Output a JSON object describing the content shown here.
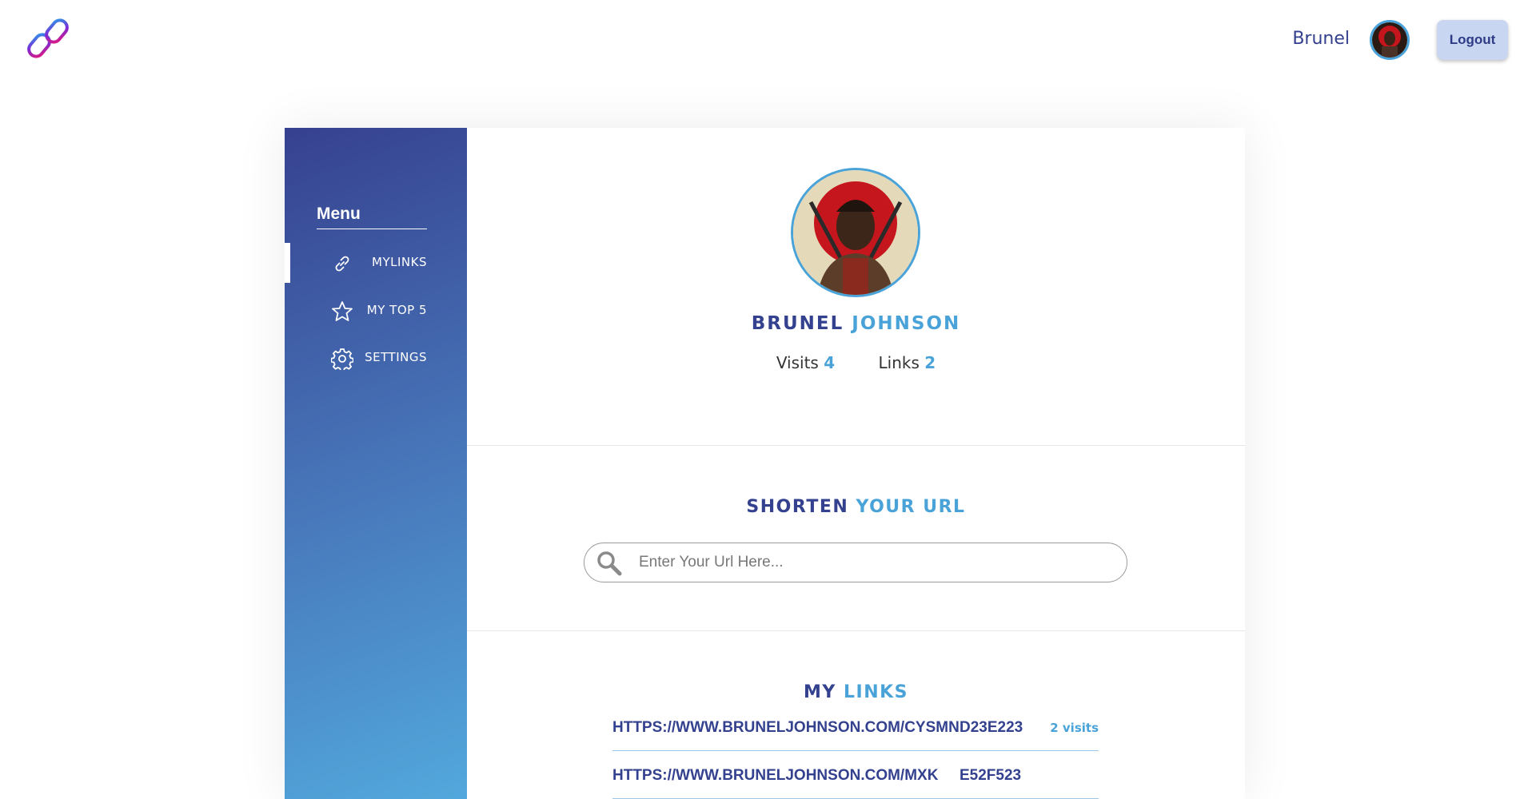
{
  "header": {
    "user_name": "Brunel",
    "logout_label": "Logout"
  },
  "sidebar": {
    "title": "Menu",
    "items": [
      {
        "label": "MYLINKS",
        "icon": "link-icon",
        "active": true
      },
      {
        "label": "MY TOP 5",
        "icon": "star-icon",
        "active": false
      },
      {
        "label": "SETTINGS",
        "icon": "gear-icon",
        "active": false
      }
    ]
  },
  "profile": {
    "first_name": "BRUNEL",
    "last_name": "JOHNSON",
    "visits_label": "Visits",
    "visits_value": "4",
    "links_label": "Links",
    "links_value": "2"
  },
  "shorten": {
    "title_a": "SHORTEN",
    "title_b": "YOUR URL",
    "placeholder": "Enter Your Url Here..."
  },
  "links": {
    "title_a": "MY",
    "title_b": "LINKS",
    "rows": [
      {
        "url": "HTTPS://WWW.BRUNELJOHNSON.COM/CYSMN",
        "code": "D23E223",
        "visits": "2 visits"
      },
      {
        "url": "HTTPS://WWW.BRUNELJOHNSON.COM/MXK",
        "code": "E52F523",
        "visits": ""
      }
    ]
  },
  "colors": {
    "brand_dark": "#33418f",
    "brand_light": "#4aa3d8",
    "logout_bg": "#c8d6f2"
  }
}
